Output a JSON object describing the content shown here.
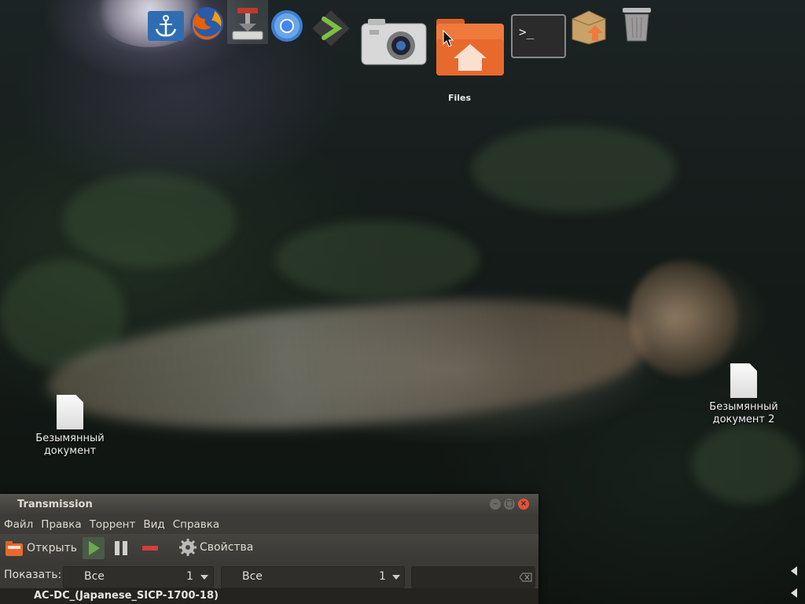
{
  "dock": {
    "items": [
      {
        "name": "anchor"
      },
      {
        "name": "firefox"
      },
      {
        "name": "transmission"
      },
      {
        "name": "chromium"
      },
      {
        "name": "launcher"
      },
      {
        "name": "camera"
      },
      {
        "name": "files"
      },
      {
        "name": "terminal"
      },
      {
        "name": "package-installer"
      },
      {
        "name": "trash"
      }
    ],
    "tooltip": "Files"
  },
  "desktop": {
    "files": [
      {
        "label": "Безымянный документ"
      },
      {
        "label": "Безымянный документ 2"
      }
    ]
  },
  "transmission": {
    "title": "Transmission",
    "menu": [
      "Файл",
      "Правка",
      "Торрент",
      "Вид",
      "Справка"
    ],
    "toolbar": {
      "open_label": "Открыть",
      "properties_label": "Свойства"
    },
    "filter": {
      "show_label": "Показать:",
      "combo1_value": "Все",
      "combo1_count": "1",
      "combo2_value": "Все",
      "combo2_count": "1",
      "search_value": ""
    },
    "torrents": [
      {
        "name": "AC-DC_(Japanese_SICP-1700-18)"
      }
    ]
  },
  "colors": {
    "close_button": "#e2533c",
    "window_bg": "#3c3b37",
    "files_orange": "#f07a3c",
    "play_green": "#6aa84f",
    "stop_red": "#d63d3d"
  }
}
